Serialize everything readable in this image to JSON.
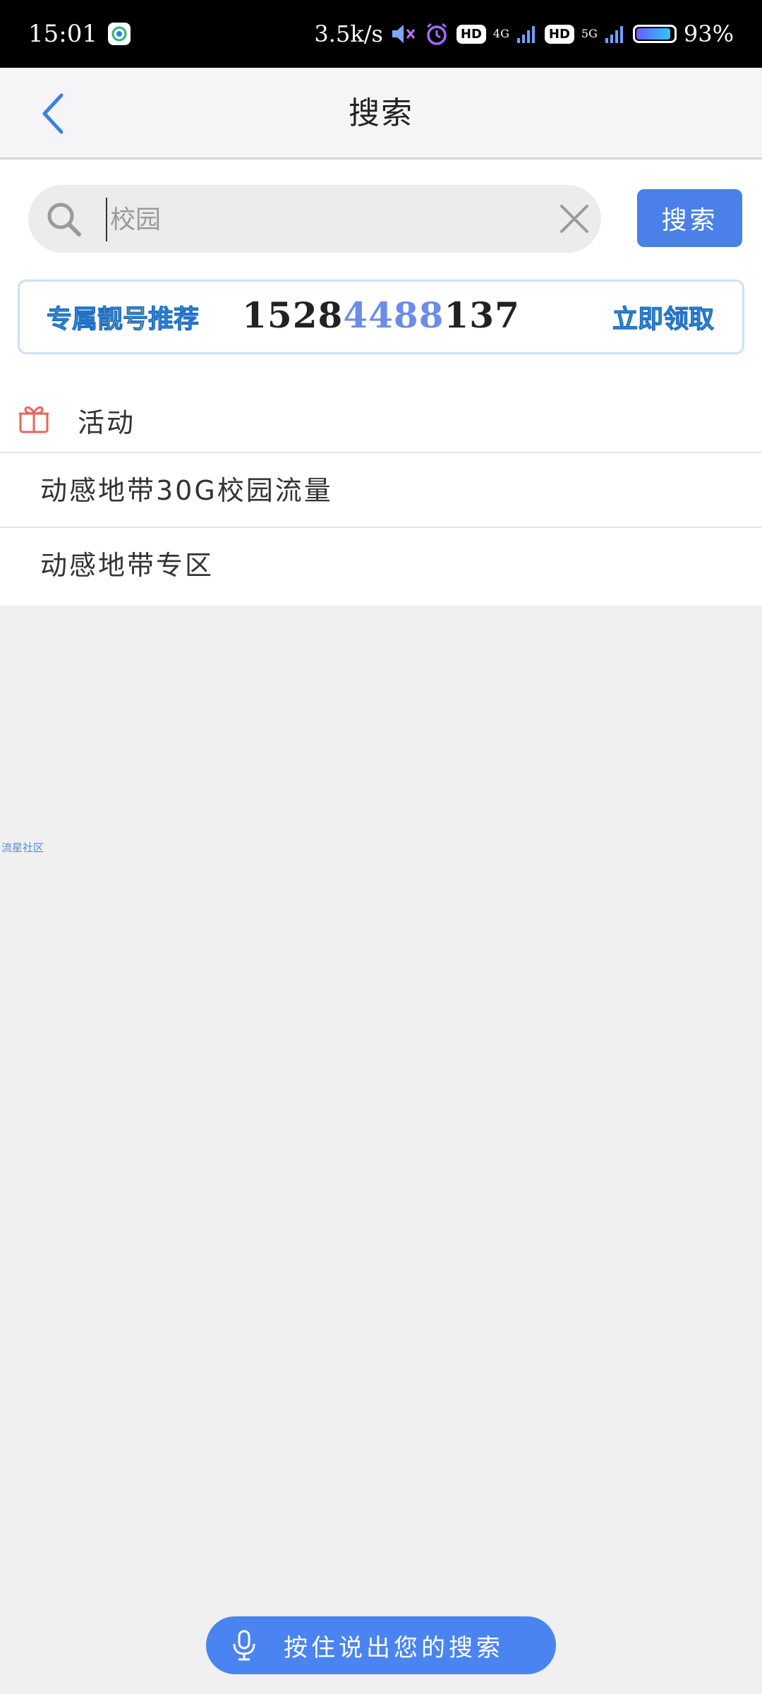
{
  "status_bar": {
    "time": "15:01",
    "net_speed": "3.5k/s",
    "hd1": "HD",
    "net1": "4G",
    "hd2": "HD",
    "net2": "5G",
    "battery": "93%",
    "battery_level": 0.93
  },
  "header": {
    "title": "搜索"
  },
  "search": {
    "value": "",
    "placeholder": "校园",
    "button_label": "搜索"
  },
  "promo": {
    "label_a": "专属",
    "label_b": "靓号",
    "label_c": "推荐",
    "number_prefix": "1528",
    "number_mid": "4488",
    "number_suffix": "137",
    "claim_label": "立即领取"
  },
  "section": {
    "title": "活动"
  },
  "results": [
    "动感地带30G校园流量",
    "动感地带专区"
  ],
  "watermark": "流星社区",
  "voice": {
    "label": "按住说出您的搜索"
  },
  "colors": {
    "accent": "#4a80e8",
    "voice_button": "#4a84f0",
    "gift_icon": "#e8665e"
  }
}
